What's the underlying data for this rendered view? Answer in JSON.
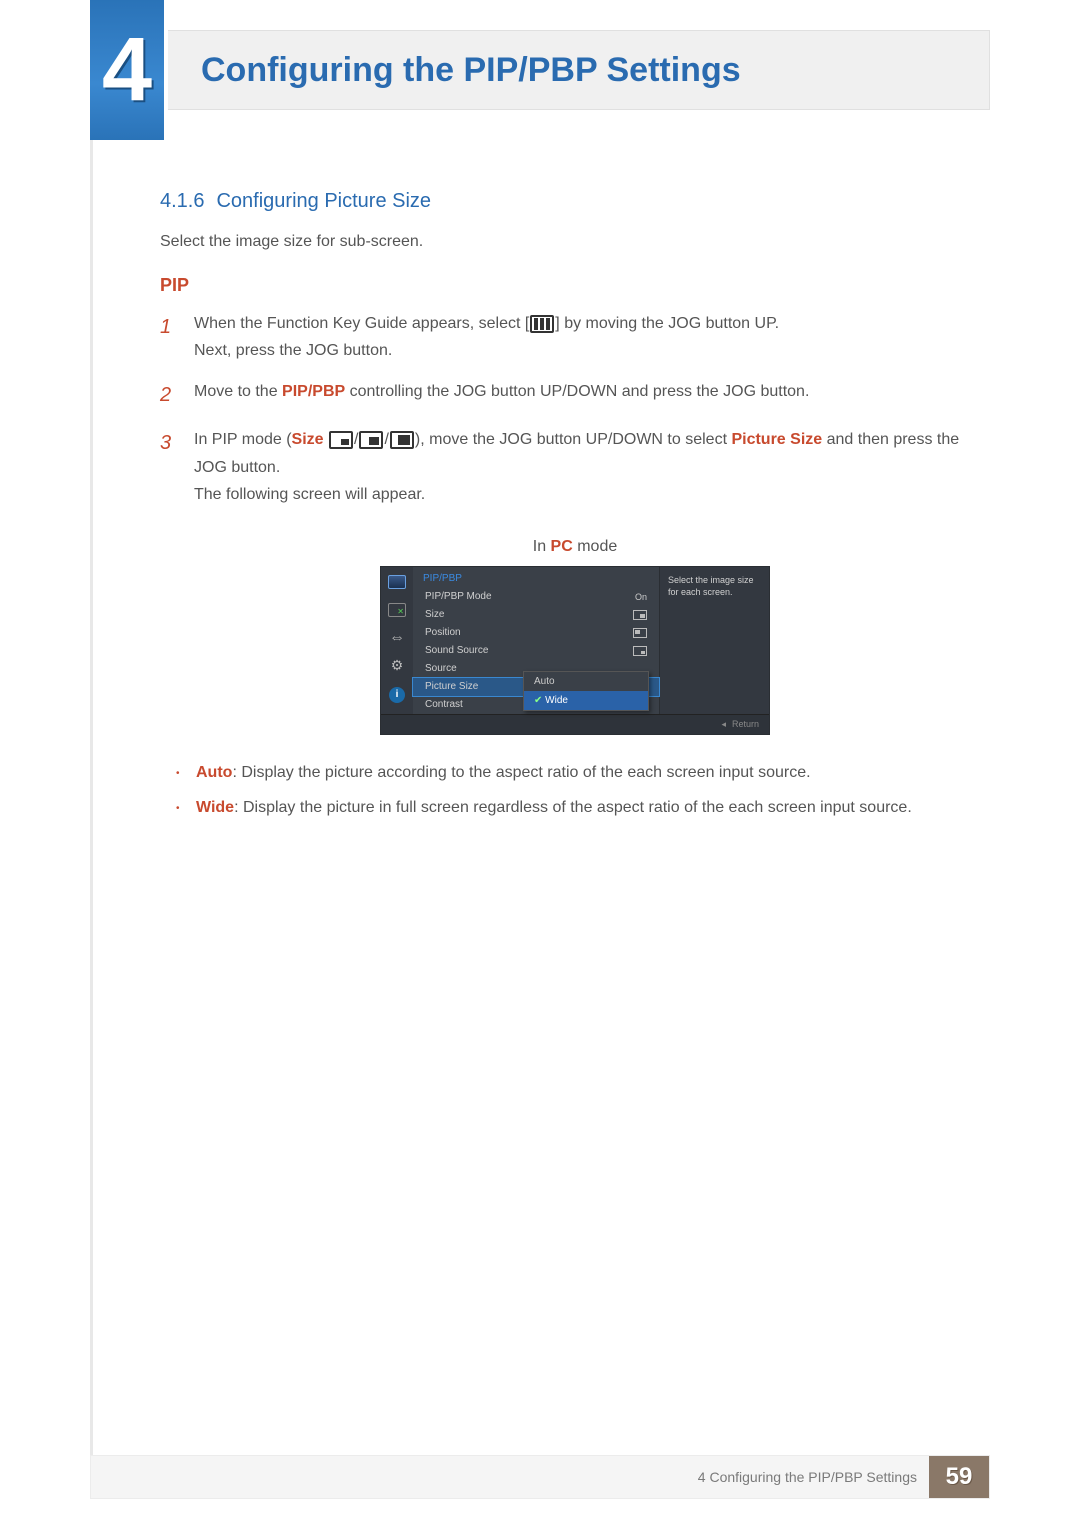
{
  "chapter_number": "4",
  "page_title": "Configuring the PIP/PBP Settings",
  "section": {
    "number": "4.1.6",
    "title": "Configuring Picture Size"
  },
  "intro": "Select the image size for sub-screen.",
  "subhead": "PIP",
  "steps": [
    {
      "n": "1",
      "line1_a": "When the Function Key Guide appears, select [",
      "line1_b": "] by moving the JOG button UP.",
      "line2": "Next, press the JOG button."
    },
    {
      "n": "2",
      "pre": "Move to the ",
      "emph": "PIP/PBP",
      "post": " controlling the JOG button UP/DOWN and press the JOG button."
    },
    {
      "n": "3",
      "a": "In PIP mode (",
      "size": "Size",
      "b": "), move the JOG button UP/DOWN to select ",
      "ps": "Picture Size",
      "c": " and then press the JOG button.",
      "line2": "The following screen will appear."
    }
  ],
  "mode_caption": {
    "pre": "In ",
    "pc": "PC",
    "post": " mode"
  },
  "osd": {
    "category": "PIP/PBP",
    "items": [
      {
        "label": "PIP/PBP Mode",
        "value": "On"
      },
      {
        "label": "Size"
      },
      {
        "label": "Position"
      },
      {
        "label": "Sound Source"
      },
      {
        "label": "Source"
      },
      {
        "label": "Picture Size"
      },
      {
        "label": "Contrast"
      }
    ],
    "dropdown": {
      "opt1": "Auto",
      "opt2": "Wide"
    },
    "desc": "Select the image size for each screen.",
    "return": "Return"
  },
  "bullets": [
    {
      "term": "Auto",
      "text": ": Display the picture according to the aspect ratio of the each screen input source."
    },
    {
      "term": "Wide",
      "text": ": Display the picture in full screen regardless of the aspect ratio of the each screen input source."
    }
  ],
  "footer": {
    "text": "4 Configuring the PIP/PBP Settings",
    "page": "59"
  }
}
